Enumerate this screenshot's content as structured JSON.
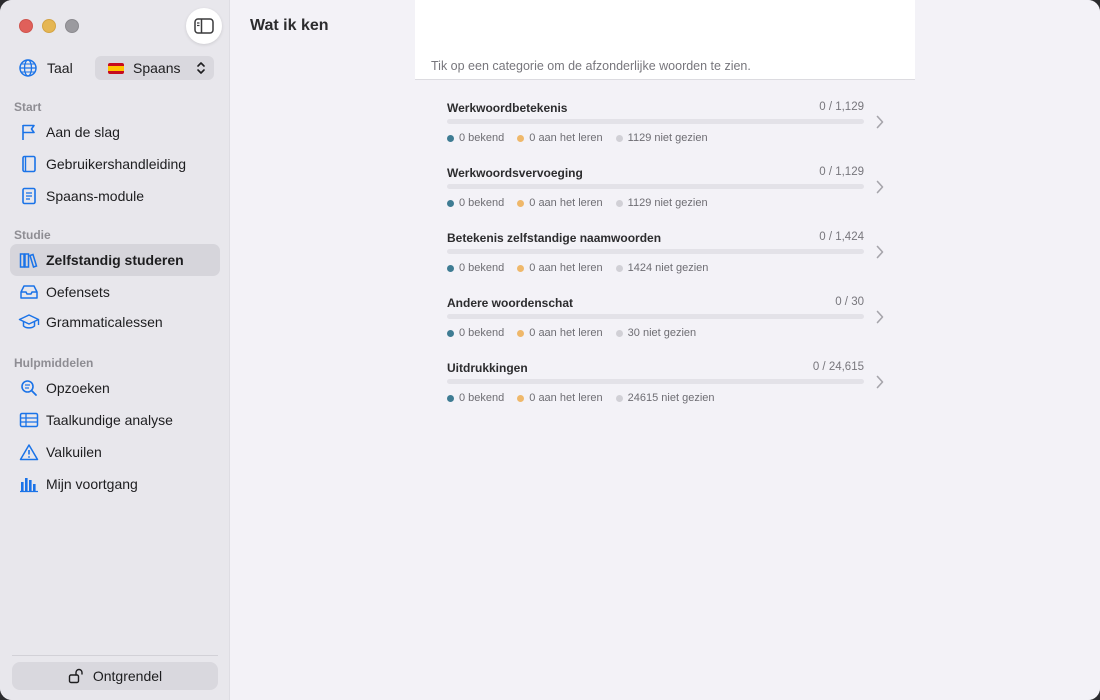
{
  "sidebar": {
    "language_label": "Taal",
    "language_value": "Spaans",
    "sections": [
      {
        "title": "Start",
        "items": [
          {
            "label": "Aan de slag",
            "icon": "flag-icon"
          },
          {
            "label": "Gebruikershandleiding",
            "icon": "book-icon"
          },
          {
            "label": "Spaans-module",
            "icon": "document-icon"
          }
        ]
      },
      {
        "title": "Studie",
        "items": [
          {
            "label": "Zelfstandig studeren",
            "icon": "books-icon",
            "active": true
          },
          {
            "label": "Oefensets",
            "icon": "tray-icon"
          },
          {
            "label": "Grammaticalessen",
            "icon": "graduation-cap-icon"
          }
        ]
      },
      {
        "title": "Hulpmiddelen",
        "items": [
          {
            "label": "Opzoeken",
            "icon": "magnifier-icon"
          },
          {
            "label": "Taalkundige analyse",
            "icon": "table-icon"
          },
          {
            "label": "Valkuilen",
            "icon": "warning-icon"
          },
          {
            "label": "Mijn voortgang",
            "icon": "bar-chart-icon"
          }
        ]
      }
    ],
    "unlock_label": "Ontgrendel"
  },
  "main": {
    "title": "Wat ik ken",
    "hint": "Tik op een categorie om de afzonderlijke woorden te zien.",
    "categories": [
      {
        "name": "Werkwoordbetekenis",
        "count": "0 / 1,129",
        "progress": 0,
        "known": "0 bekend",
        "learning": "0 aan het leren",
        "unseen": "1129 niet gezien"
      },
      {
        "name": "Werkwoordsvervoeging",
        "count": "0 / 1,129",
        "progress": 0,
        "known": "0 bekend",
        "learning": "0 aan het leren",
        "unseen": "1129 niet gezien"
      },
      {
        "name": "Betekenis zelfstandige naamwoorden",
        "count": "0 / 1,424",
        "progress": 0,
        "known": "0 bekend",
        "learning": "0 aan het leren",
        "unseen": "1424 niet gezien"
      },
      {
        "name": "Andere woordenschat",
        "count": "0 / 30",
        "progress": 0,
        "known": "0 bekend",
        "learning": "0 aan het leren",
        "unseen": "30 niet gezien"
      },
      {
        "name": "Uitdrukkingen",
        "count": "0 / 24,615",
        "progress": 0,
        "known": "0 bekend",
        "learning": "0 aan het leren",
        "unseen": "24615 niet gezien"
      }
    ]
  },
  "colors": {
    "accent": "#1a73e8",
    "known": "#3e7c93",
    "learning": "#efb86a",
    "unseen": "#d1d0d6"
  }
}
